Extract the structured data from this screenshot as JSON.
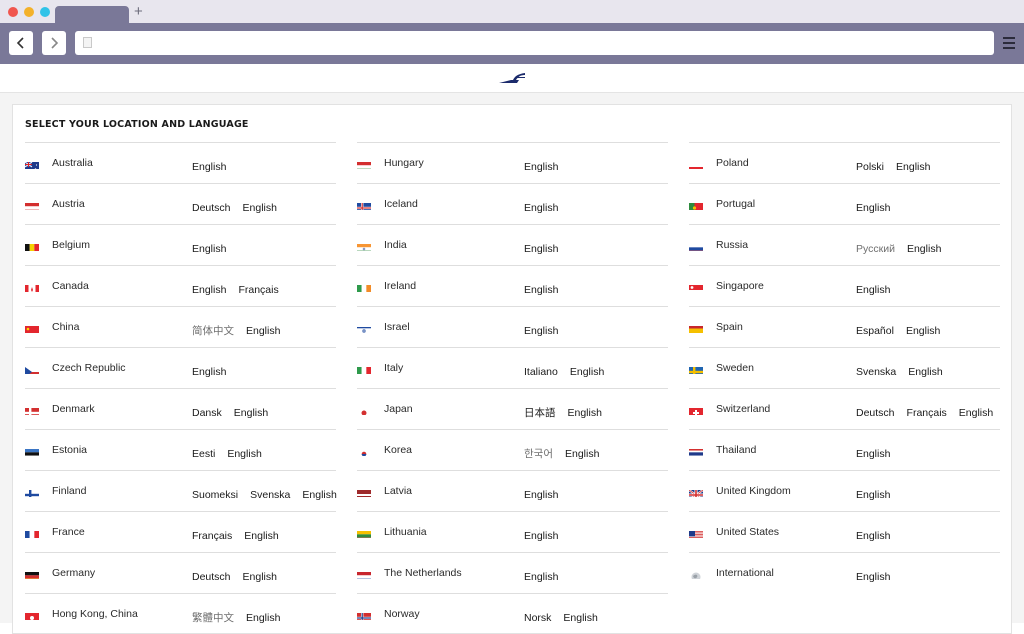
{
  "browser": {
    "new_tab_label": "+",
    "url": ""
  },
  "page": {
    "title": "SELECT YOUR LOCATION AND LANGUAGE"
  },
  "columns": [
    [
      {
        "country": "Australia",
        "flag": "au",
        "langs": [
          {
            "t": "English"
          }
        ]
      },
      {
        "country": "Austria",
        "flag": "at",
        "langs": [
          {
            "t": "Deutsch"
          },
          {
            "t": "English"
          }
        ]
      },
      {
        "country": "Belgium",
        "flag": "be",
        "langs": [
          {
            "t": "English"
          }
        ]
      },
      {
        "country": "Canada",
        "flag": "ca",
        "langs": [
          {
            "t": "English"
          },
          {
            "t": "Français"
          }
        ]
      },
      {
        "country": "China",
        "flag": "cn",
        "langs": [
          {
            "t": "简体中文",
            "muted": true
          },
          {
            "t": "English"
          }
        ]
      },
      {
        "country": "Czech Republic",
        "flag": "cz",
        "langs": [
          {
            "t": "English"
          }
        ]
      },
      {
        "country": "Denmark",
        "flag": "dk",
        "langs": [
          {
            "t": "Dansk"
          },
          {
            "t": "English"
          }
        ]
      },
      {
        "country": "Estonia",
        "flag": "ee",
        "langs": [
          {
            "t": "Eesti"
          },
          {
            "t": "English"
          }
        ]
      },
      {
        "country": "Finland",
        "flag": "fi",
        "langs": [
          {
            "t": "Suomeksi"
          },
          {
            "t": "Svenska"
          },
          {
            "t": "English"
          }
        ]
      },
      {
        "country": "France",
        "flag": "fr",
        "langs": [
          {
            "t": "Français"
          },
          {
            "t": "English"
          }
        ]
      },
      {
        "country": "Germany",
        "flag": "de",
        "langs": [
          {
            "t": "Deutsch"
          },
          {
            "t": "English"
          }
        ]
      },
      {
        "country": "Hong Kong, China",
        "flag": "hk",
        "langs": [
          {
            "t": "繁體中文",
            "muted": true
          },
          {
            "t": "English"
          }
        ]
      }
    ],
    [
      {
        "country": "Hungary",
        "flag": "hu",
        "langs": [
          {
            "t": "English"
          }
        ]
      },
      {
        "country": "Iceland",
        "flag": "is",
        "langs": [
          {
            "t": "English"
          }
        ]
      },
      {
        "country": "India",
        "flag": "in",
        "langs": [
          {
            "t": "English"
          }
        ]
      },
      {
        "country": "Ireland",
        "flag": "ie",
        "langs": [
          {
            "t": "English"
          }
        ]
      },
      {
        "country": "Israel",
        "flag": "il",
        "langs": [
          {
            "t": "English"
          }
        ]
      },
      {
        "country": "Italy",
        "flag": "it",
        "langs": [
          {
            "t": "Italiano"
          },
          {
            "t": "English"
          }
        ]
      },
      {
        "country": "Japan",
        "flag": "jp",
        "langs": [
          {
            "t": "日本語"
          },
          {
            "t": "English"
          }
        ]
      },
      {
        "country": "Korea",
        "flag": "kr",
        "langs": [
          {
            "t": "한국어",
            "muted": true
          },
          {
            "t": "English"
          }
        ]
      },
      {
        "country": "Latvia",
        "flag": "lv",
        "langs": [
          {
            "t": "English"
          }
        ]
      },
      {
        "country": "Lithuania",
        "flag": "lt",
        "langs": [
          {
            "t": "English"
          }
        ]
      },
      {
        "country": "The Netherlands",
        "flag": "nl",
        "langs": [
          {
            "t": "English"
          }
        ]
      },
      {
        "country": "Norway",
        "flag": "no",
        "langs": [
          {
            "t": "Norsk"
          },
          {
            "t": "English"
          }
        ]
      }
    ],
    [
      {
        "country": "Poland",
        "flag": "pl",
        "langs": [
          {
            "t": "Polski"
          },
          {
            "t": "English"
          }
        ]
      },
      {
        "country": "Portugal",
        "flag": "pt",
        "langs": [
          {
            "t": "English"
          }
        ]
      },
      {
        "country": "Russia",
        "flag": "ru",
        "langs": [
          {
            "t": "Русский",
            "muted": true
          },
          {
            "t": "English"
          }
        ]
      },
      {
        "country": "Singapore",
        "flag": "sg",
        "langs": [
          {
            "t": "English"
          }
        ]
      },
      {
        "country": "Spain",
        "flag": "es",
        "langs": [
          {
            "t": "Español"
          },
          {
            "t": "English"
          }
        ]
      },
      {
        "country": "Sweden",
        "flag": "se",
        "langs": [
          {
            "t": "Svenska"
          },
          {
            "t": "English"
          }
        ]
      },
      {
        "country": "Switzerland",
        "flag": "ch",
        "langs": [
          {
            "t": "Deutsch"
          },
          {
            "t": "Français"
          },
          {
            "t": "English"
          }
        ]
      },
      {
        "country": "Thailand",
        "flag": "th",
        "langs": [
          {
            "t": "English"
          }
        ]
      },
      {
        "country": "United Kingdom",
        "flag": "gb",
        "langs": [
          {
            "t": "English"
          }
        ]
      },
      {
        "country": "United States",
        "flag": "us",
        "langs": [
          {
            "t": "English"
          }
        ]
      },
      {
        "country": "International",
        "flag": "intl",
        "langs": [
          {
            "t": "English"
          }
        ]
      }
    ]
  ],
  "colors": {
    "toolbar": "#7a7898",
    "brand_navy": "#1b2a6b"
  }
}
